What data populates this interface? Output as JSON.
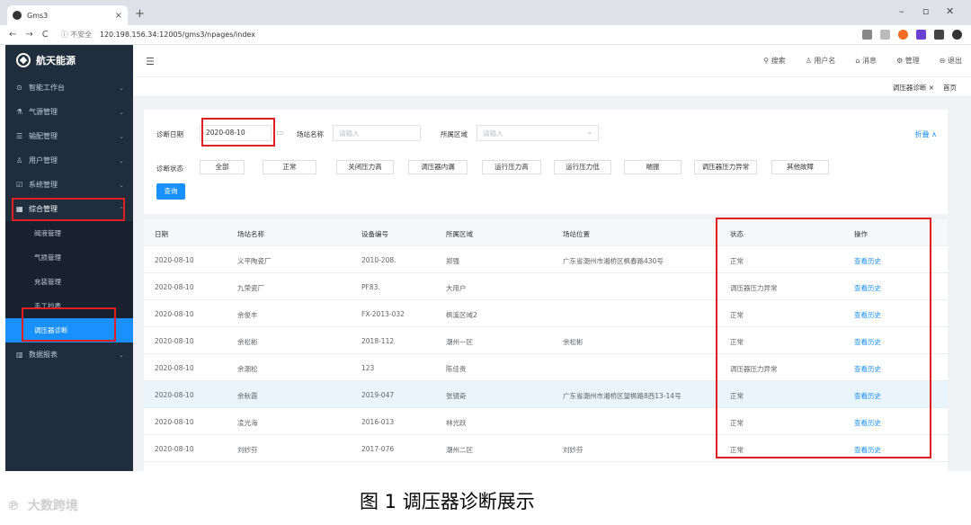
{
  "browser": {
    "tab_title": "Gms3",
    "tab_close": "×",
    "new_tab": "+",
    "back": "←",
    "forward": "→",
    "reload": "C",
    "insecure_label": "ⓘ 不安全",
    "url": "120.198.156.34:12005/gms3/npages/index",
    "win_min": "–",
    "win_max": "▫",
    "win_close": "✕"
  },
  "sidebar": {
    "logo": "航天能源",
    "menu": [
      {
        "icon": "⊙",
        "label": "智能工作台",
        "chev": "⌄"
      },
      {
        "icon": "⚗",
        "label": "气源管理",
        "chev": "⌄"
      },
      {
        "icon": "☰",
        "label": "输配管理",
        "chev": "⌄"
      },
      {
        "icon": "♙",
        "label": "用户管理",
        "chev": "⌄"
      },
      {
        "icon": "☑",
        "label": "系统管理",
        "chev": "⌄"
      },
      {
        "icon": "▦",
        "label": "综合管理",
        "chev": "⌃"
      }
    ],
    "sub": [
      "阀液管理",
      "气损管理",
      "充装管理",
      "手工抄表",
      "调压器诊断"
    ],
    "last": {
      "icon": "▥",
      "label": "数据报表",
      "chev": "⌄"
    }
  },
  "topbar": {
    "hamburger": "☰",
    "search": "⚲ 搜索",
    "user": "♙ 用户名",
    "message": "⌂ 消息",
    "manage": "⚙ 管理",
    "logout": "⊖ 退出"
  },
  "tags": {
    "active": "调压器诊断 ×",
    "home": "首页"
  },
  "filter": {
    "date_label": "诊断日期",
    "date_value": "2020-08-10",
    "station_label": "场站名称",
    "station_placeholder": "请输入",
    "area_label": "所属区域",
    "area_placeholder": "请输入",
    "area_arrow": "⌄",
    "collapse": "折叠 ∧",
    "status_label": "诊断状态",
    "statuses": [
      "全部",
      "正常",
      "关闭压力高",
      "调压器内漏",
      "运行压力高",
      "运行压力低",
      "喘振",
      "调压器压力异常",
      "其他故障"
    ],
    "query": "查询"
  },
  "table": {
    "headers": [
      "日期",
      "场站名称",
      "设备编号",
      "所属区域",
      "场站位置",
      "状态",
      "操作"
    ],
    "rows": [
      [
        "2020-08-10",
        "义平陶瓷厂",
        "2010-208.",
        "郑强",
        "广东省潮州市湘桥区枫春路430号",
        "正常",
        "查看历史"
      ],
      [
        "2020-08-10",
        "九荣瓷厂",
        "PF83.",
        "大用户",
        "",
        "调压器压力异常",
        "查看历史"
      ],
      [
        "2020-08-10",
        "余俊丰",
        "FX-2013-032",
        "枫溪区域2",
        "",
        "正常",
        "查看历史"
      ],
      [
        "2020-08-10",
        "余松彬",
        "2018-112",
        "潮州一区",
        "余松彬",
        "正常",
        "查看历史"
      ],
      [
        "2020-08-10",
        "余潮松",
        "123",
        "陈佳贵",
        "",
        "调压器压力异常",
        "查看历史"
      ],
      [
        "2020-08-10",
        "余秋霞",
        "2019-047",
        "张镜奇",
        "广东省潮州市湘桥区望枫路8西13-14号",
        "正常",
        "查看历史"
      ],
      [
        "2020-08-10",
        "凌光海",
        "2016-013",
        "林光跃",
        "",
        "正常",
        "查看历史"
      ],
      [
        "2020-08-10",
        "刘妙芬",
        "2017-076",
        "潮州二区",
        "刘妙芬",
        "正常",
        "查看历史"
      ]
    ]
  },
  "watermark": "大数跨境",
  "caption": "图 1  调压器诊断展示"
}
